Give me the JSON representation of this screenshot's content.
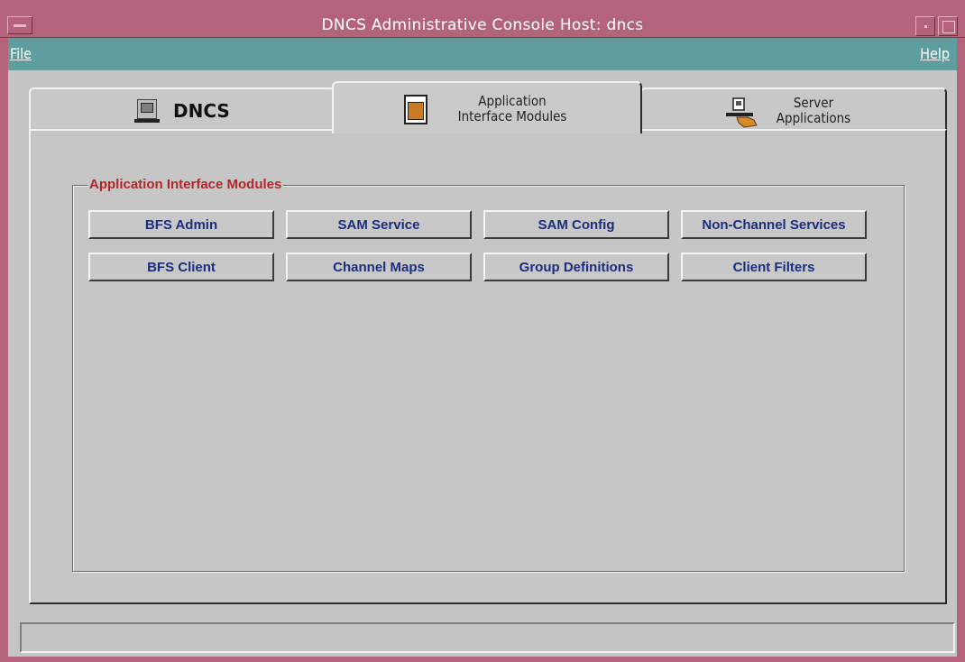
{
  "window": {
    "title": "DNCS Administrative Console   Host: dncs"
  },
  "menubar": {
    "file": "File",
    "help": "Help"
  },
  "tabs": [
    {
      "label": "DNCS",
      "icon": "monitor-icon",
      "selected": false
    },
    {
      "label": "Application\nInterface Modules",
      "line1": "Application",
      "line2": "Interface Modules",
      "icon": "document-icon",
      "selected": true
    },
    {
      "label": "Server\nApplications",
      "line1": "Server",
      "line2": "Applications",
      "icon": "server-hand-icon",
      "selected": false
    }
  ],
  "group": {
    "title": "Application Interface Modules",
    "buttons": [
      "BFS Admin",
      "SAM Service",
      "SAM Config",
      "Non-Channel Services",
      "BFS Client",
      "Channel Maps",
      "Group Definitions",
      "Client Filters"
    ]
  },
  "colors": {
    "titlebar": "#b3647a",
    "menubar": "#5f9e9e",
    "group_title": "#b3262a",
    "button_text": "#1b2d7d"
  }
}
